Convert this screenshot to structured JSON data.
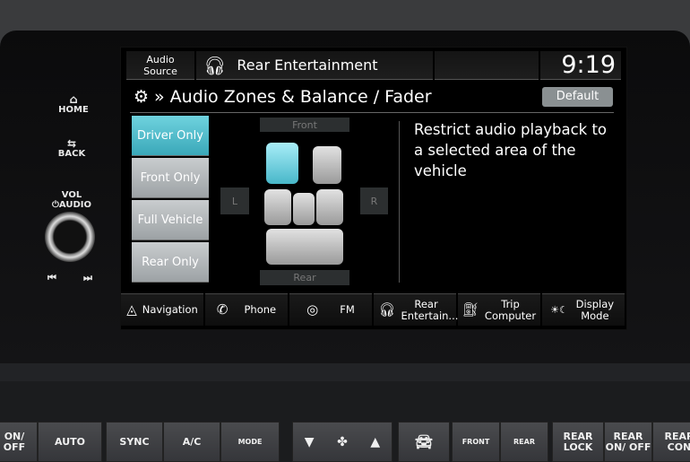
{
  "bezel": {
    "home_label": "HOME",
    "back_label": "BACK",
    "vol_label": "VOL",
    "audio_label": "AUDIO",
    "prev_icon": "skip-back-icon",
    "next_icon": "skip-forward-icon"
  },
  "header": {
    "audio_source_line1": "Audio",
    "audio_source_line2": "Source",
    "source_name": "Rear Entertainment",
    "source_icon": "headphones-icon",
    "clock": "9:19"
  },
  "title": {
    "text": "Audio Zones & Balance / Fader",
    "icon": "gear-icon",
    "default_label": "Default"
  },
  "zones": {
    "items": [
      {
        "label": "Driver Only",
        "active": true
      },
      {
        "label": "Front Only",
        "active": false
      },
      {
        "label": "Full Vehicle",
        "active": false
      },
      {
        "label": "Rear Only",
        "active": false
      }
    ],
    "front": "Front",
    "rear": "Rear",
    "left": "L",
    "right": "R",
    "accent": "#4bbccb"
  },
  "description": "Restrict audio playback to a selected area of the vehicle",
  "bottom_bar": [
    {
      "label": "Navigation",
      "icon": "navigation-icon"
    },
    {
      "label": "Phone",
      "icon": "phone-icon"
    },
    {
      "label": "FM",
      "icon": "radio-icon"
    },
    {
      "label": "Rear Entertain...",
      "icon": "headphones-icon"
    },
    {
      "label": "Trip Computer",
      "icon": "fuel-icon"
    },
    {
      "label": "Display Mode",
      "icon": "day-night-icon"
    }
  ],
  "climate": [
    "ON/ OFF",
    "AUTO",
    "SYNC",
    "A/C",
    "MODE",
    "▼",
    "▲",
    "FRONT",
    "REAR",
    "REAR LOCK",
    "REAR ON/ OFF",
    "REAR CON"
  ]
}
